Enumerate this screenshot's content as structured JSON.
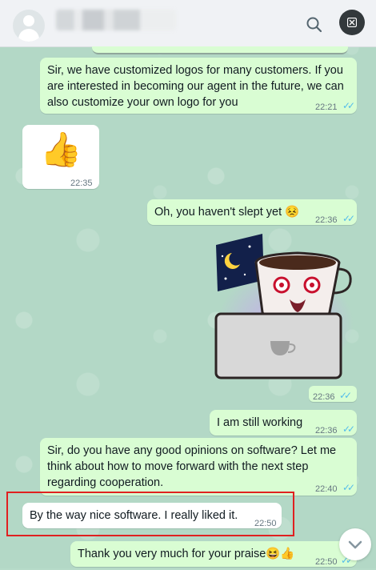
{
  "header": {
    "contact_name": "▒▒▒▒ ▒▒▒▒",
    "search_icon": "search-icon",
    "close_icon": "close-icon"
  },
  "messages": [
    {
      "type": "text",
      "text": "Sir, we have customized logos for many customers. If you are interested in becoming our agent in the future, we can also customize your own logo for you",
      "time": "22:21",
      "status": "read"
    },
    {
      "type": "emoji",
      "emoji": "👍",
      "time": "22:35"
    },
    {
      "type": "text",
      "text": "Oh, you haven't slept yet 😣",
      "time": "22:36",
      "status": "read"
    },
    {
      "type": "sticker",
      "name": "coffee-cup-laptop-sticker",
      "time": "22:36",
      "status": "read"
    },
    {
      "type": "text",
      "text": "I am still working",
      "time": "22:36",
      "status": "read"
    },
    {
      "type": "text",
      "text": "Sir, do you have any good opinions on software? Let me think about how to move forward with the next step regarding cooperation.",
      "time": "22:40",
      "status": "read"
    },
    {
      "type": "text",
      "text": "By the way nice software. I really liked it.",
      "time": "22:50"
    },
    {
      "type": "text",
      "text": "Thank you very much for your praise😆👍",
      "time": "22:50",
      "status": "read"
    }
  ],
  "colors": {
    "outgoing": "#d9fdd3",
    "incoming": "#ffffff",
    "chat_background": "#b3d8c6",
    "highlight": "#e02020",
    "read_ticks": "#53bdeb"
  }
}
